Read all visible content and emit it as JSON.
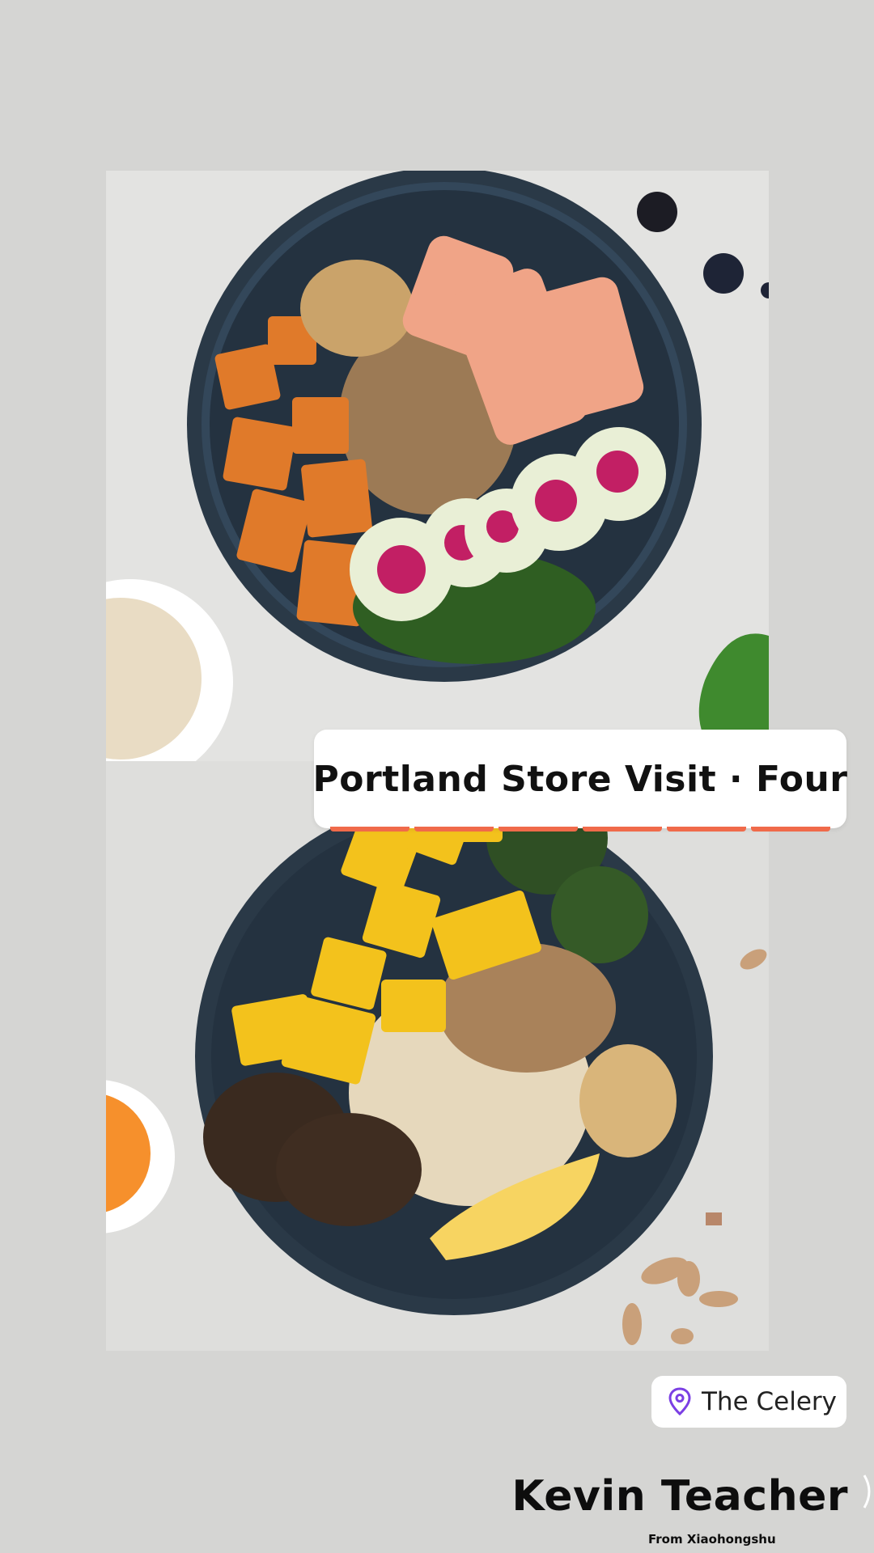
{
  "post": {
    "title": "Portland Store Visit · Four",
    "location": {
      "icon": "map-pin-icon",
      "name": "The Celery",
      "icon_color": "#7b3fe4"
    },
    "author": "Kevin Teacher",
    "source": "From Xiaohongshu"
  },
  "images": [
    {
      "name": "salmon-grain-bowl-photo"
    },
    {
      "name": "chicken-mango-bowl-photo"
    }
  ],
  "colors": {
    "background": "#d5d5d3",
    "card": "#ffffff",
    "accent_underline": "#f06a4a",
    "bowl": "#2b3a48"
  }
}
